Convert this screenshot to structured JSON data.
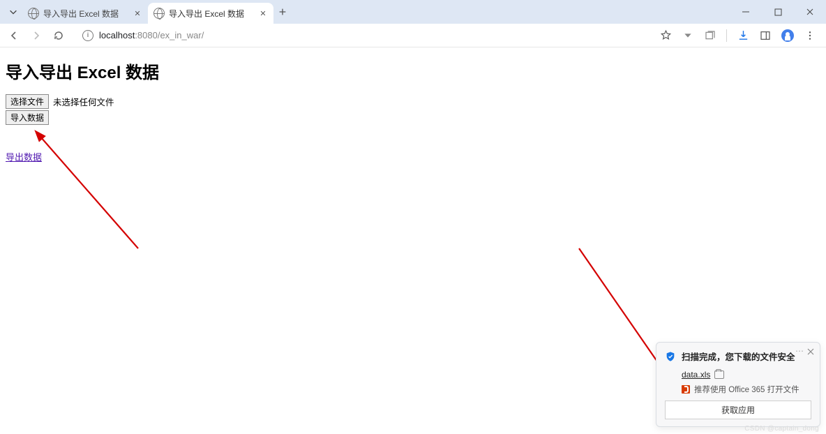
{
  "tabs": [
    {
      "title": "导入导出 Excel 数据"
    },
    {
      "title": "导入导出 Excel 数据"
    }
  ],
  "address": {
    "host": "localhost",
    "portpath": ":8080/ex_in_war/"
  },
  "page": {
    "heading": "导入导出 Excel 数据",
    "choose_file_btn": "选择文件",
    "file_status": "未选择任何文件",
    "import_btn": "导入数据",
    "export_link": "导出数据"
  },
  "notification": {
    "title": "扫描完成，您下载的文件安全",
    "filename": "data.xls",
    "recommend": "推荐使用 Office 365 打开文件",
    "action": "获取应用"
  },
  "watermark": "CSDN @captain_dong"
}
